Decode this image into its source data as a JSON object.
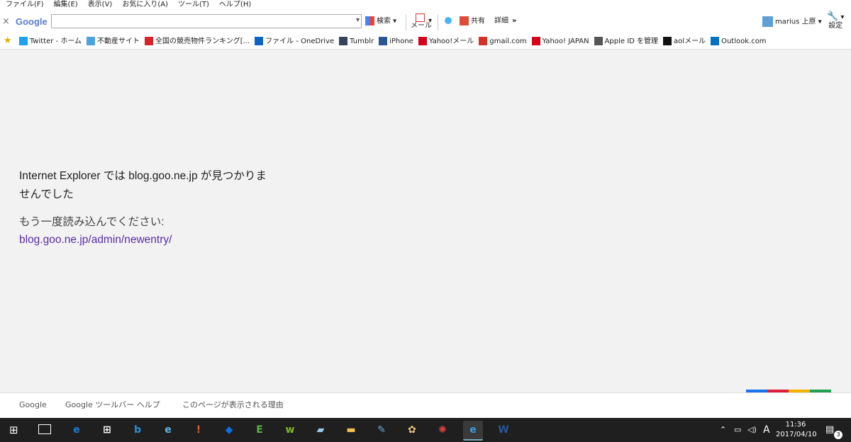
{
  "menu": {
    "items": [
      "ファイル(F)",
      "編集(E)",
      "表示(V)",
      "お気に入り(A)",
      "ツール(T)",
      "ヘルプ(H)"
    ]
  },
  "toolbar": {
    "close": "×",
    "logo": "Google",
    "search_value": "",
    "search_label": "検索",
    "mail_label": "メール",
    "share_label": "共有",
    "detail_label": "詳細",
    "more": "»",
    "user": "marius 上原",
    "settings_label": "設定"
  },
  "bookmarks": [
    {
      "label": "Twitter - ホーム",
      "icon": "twitter-icon",
      "color": "#1da1f2"
    },
    {
      "label": "不動産サイト",
      "icon": "page-icon",
      "color": "#4aa3df"
    },
    {
      "label": "全国の競売物件ランキング[...",
      "icon": "x-icon",
      "color": "#d8232a"
    },
    {
      "label": "ファイル - OneDrive",
      "icon": "cloud-icon",
      "color": "#0a64c8"
    },
    {
      "label": "Tumblr",
      "icon": "tumblr-icon",
      "color": "#35465c"
    },
    {
      "label": "iPhone",
      "icon": "iw-icon",
      "color": "#2b5797"
    },
    {
      "label": "Yahoo!メール",
      "icon": "yahoo-icon",
      "color": "#d5001c"
    },
    {
      "label": "gmail.com",
      "icon": "gmail-icon",
      "color": "#d93025"
    },
    {
      "label": "Yahoo! JAPAN",
      "icon": "yahoo-icon",
      "color": "#d5001c"
    },
    {
      "label": "Apple ID を管理",
      "icon": "apple-icon",
      "color": "#555555"
    },
    {
      "label": "aolメール",
      "icon": "aol-icon",
      "color": "#111111"
    },
    {
      "label": "Outlook.com",
      "icon": "outlook-icon",
      "color": "#0072c6"
    }
  ],
  "error": {
    "title": "Internet Explorer では blog.goo.ne.jp が見つかりませんでした",
    "subtitle": "もう一度読み込んでください:",
    "link": "blog.goo.ne.jp/admin/newentry/"
  },
  "footer": {
    "links": [
      "Google",
      "Google ツールバー ヘルプ",
      "このページが表示される理由"
    ]
  },
  "taskbar": {
    "apps": [
      {
        "name": "edge-icon",
        "color": "#1e7fd6",
        "glyph": "e"
      },
      {
        "name": "store-icon",
        "color": "#ffffff",
        "glyph": "⊞"
      },
      {
        "name": "bing-icon",
        "color": "#2b8fd6",
        "glyph": "b"
      },
      {
        "name": "ie-icon",
        "color": "#5fb8e8",
        "glyph": "e"
      },
      {
        "name": "app-orange-icon",
        "color": "#e06030",
        "glyph": "!"
      },
      {
        "name": "dropbox-icon",
        "color": "#0d6fe0",
        "glyph": "◆"
      },
      {
        "name": "evernote-icon",
        "color": "#5bb34a",
        "glyph": "E"
      },
      {
        "name": "w-app-icon",
        "color": "#7dbb2b",
        "glyph": "w"
      },
      {
        "name": "viewer-icon",
        "color": "#9bc8e8",
        "glyph": "▰"
      },
      {
        "name": "folder-icon",
        "color": "#f1c24a",
        "glyph": "▬"
      },
      {
        "name": "pen-icon",
        "color": "#6aa8d8",
        "glyph": "✎"
      },
      {
        "name": "paint-icon",
        "color": "#e8c080",
        "glyph": "✿"
      },
      {
        "name": "app-red-icon",
        "color": "#d84040",
        "glyph": "✺"
      },
      {
        "name": "ie-active-icon",
        "color": "#3c9ce0",
        "glyph": "e"
      },
      {
        "name": "word-icon",
        "color": "#2b5797",
        "glyph": "W"
      }
    ],
    "ime": "A",
    "time": "11:36",
    "date": "2017/04/10",
    "notifications": "3"
  },
  "colors": {
    "link": "#5a2ca8",
    "google_bar": [
      "#1a73e8",
      "#e01e3c",
      "#f4b400",
      "#20a050"
    ]
  }
}
